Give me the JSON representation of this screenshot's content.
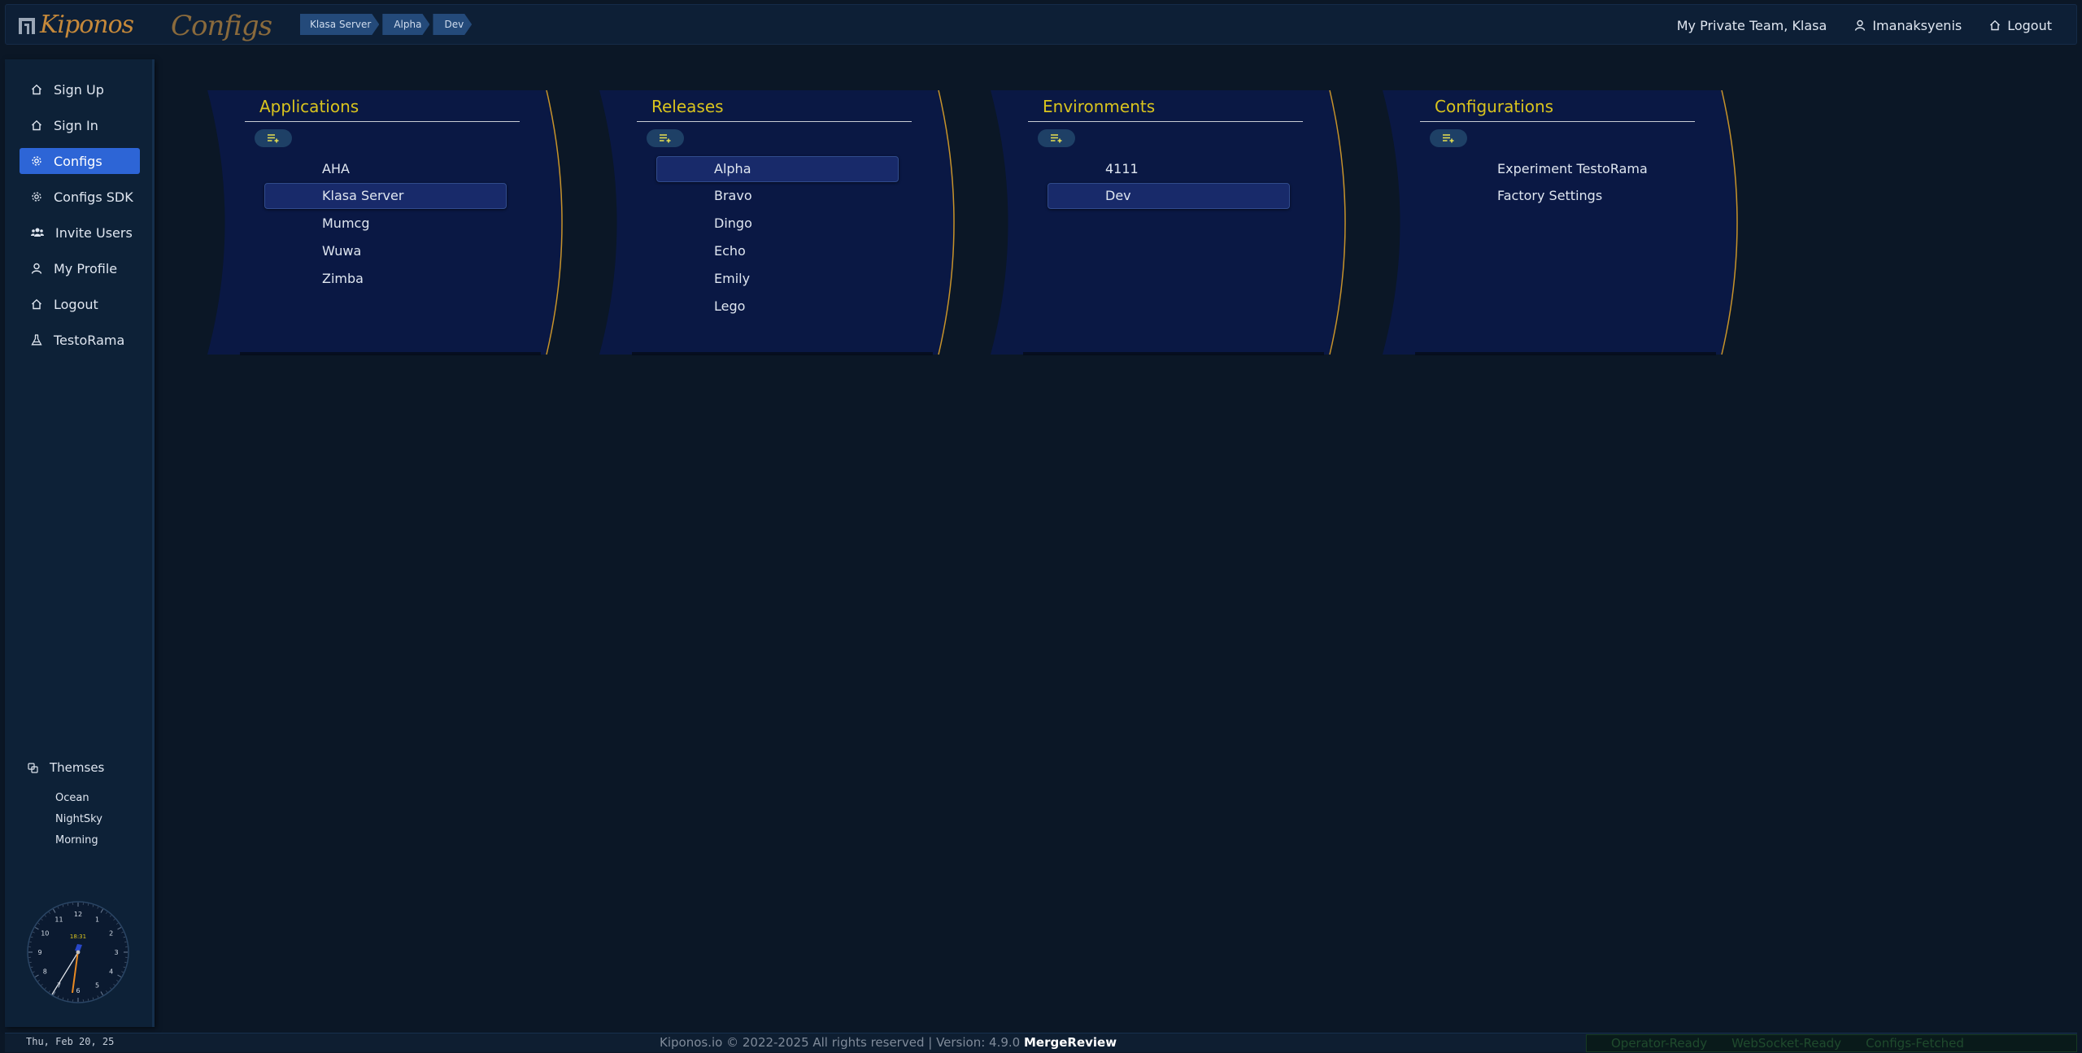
{
  "header": {
    "logo_text": "Kiponos",
    "app_title": "Configs",
    "breadcrumbs": [
      "Klasa Server",
      "Alpha",
      "Dev"
    ],
    "team": "My Private Team,  Klasa",
    "user": "Imanaksyenis",
    "logout": "Logout"
  },
  "sidebar": {
    "items": [
      {
        "label": "Sign Up",
        "icon": "home-icon"
      },
      {
        "label": "Sign In",
        "icon": "home-icon"
      },
      {
        "label": "Configs",
        "icon": "gear-icon",
        "active": true
      },
      {
        "label": "Configs SDK",
        "icon": "gear-icon"
      },
      {
        "label": "Invite Users",
        "icon": "users-icon"
      },
      {
        "label": "My Profile",
        "icon": "user-icon"
      },
      {
        "label": "Logout",
        "icon": "home-icon"
      },
      {
        "label": "TestoRama",
        "icon": "flask-icon"
      }
    ],
    "themes": {
      "title": "Themses",
      "options": [
        "Ocean",
        "NightSky",
        "Morning"
      ]
    },
    "clock": {
      "digital": "18:31",
      "numbers": [
        "12",
        "1",
        "2",
        "3",
        "4",
        "5",
        "6",
        "7",
        "8",
        "9",
        "10",
        "11"
      ]
    }
  },
  "panels": [
    {
      "title": "Applications",
      "items": [
        "AHA",
        "Klasa Server",
        "Mumcg",
        "Wuwa",
        "Zimba"
      ],
      "selected": "Klasa Server"
    },
    {
      "title": "Releases",
      "items": [
        "Alpha",
        "Bravo",
        "Dingo",
        "Echo",
        "Emily",
        "Lego"
      ],
      "selected": "Alpha"
    },
    {
      "title": "Environments",
      "items": [
        "4111",
        "Dev"
      ],
      "selected": "Dev"
    },
    {
      "title": "Configurations",
      "items": [
        "Experiment TestoRama",
        "Factory Settings"
      ],
      "selected": ""
    }
  ],
  "footer": {
    "date": "Thu, Feb 20, 25",
    "copyright": "Kiponos.io © 2022-2025 All rights reserved | Version: 4.9.0",
    "build": "MergeReview",
    "statuses": [
      "Operator-Ready",
      "WebSocket-Ready",
      "Configs-Fetched"
    ]
  },
  "colors": {
    "accent": "#2d65d6",
    "panel_title": "#d9c41e",
    "panel_bg": "#0a1844",
    "panel_edge": "#c7932a",
    "selected_bg": "#182a6a"
  }
}
